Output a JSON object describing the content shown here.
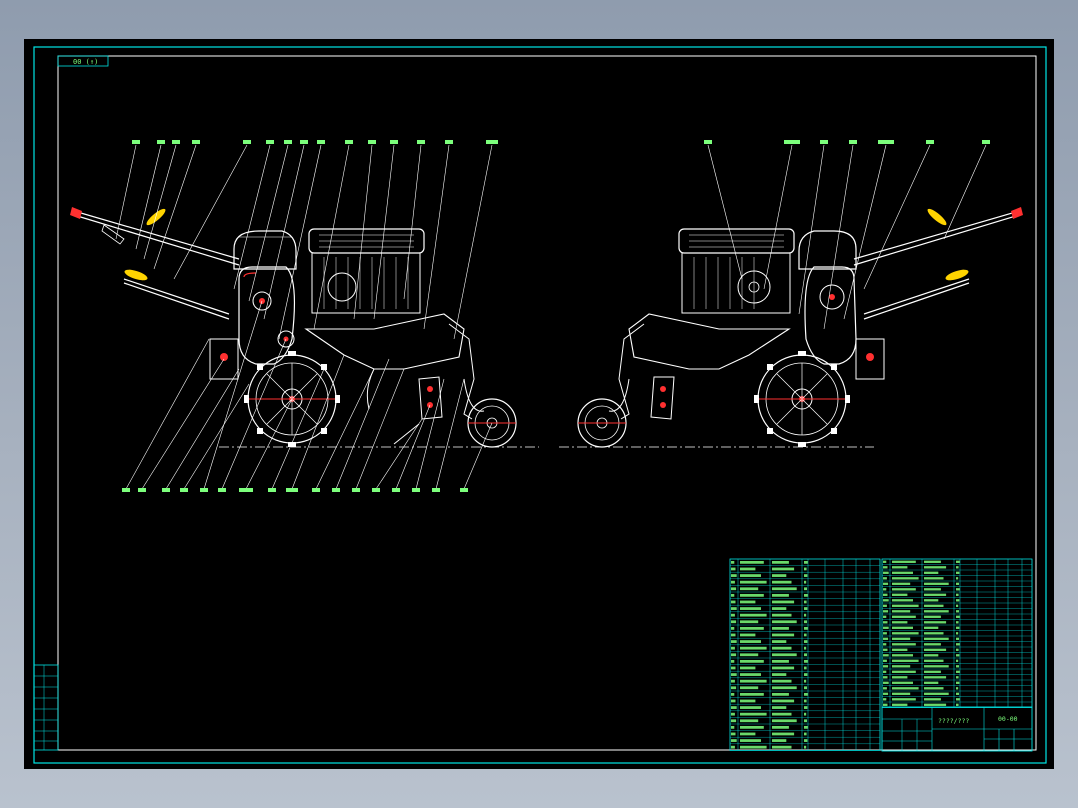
{
  "drawing": {
    "sheet_code": "00 (↑)",
    "title_block": {
      "drawing_name": "????/???",
      "drawing_no": "00-00"
    }
  },
  "colors": {
    "background": "#000000",
    "border": "#00e5e5",
    "lines": "#ffffff",
    "leaders": "#ffffff",
    "labels": "#7cff7c",
    "accent": "#ff3030",
    "handle": "#ffd400"
  }
}
